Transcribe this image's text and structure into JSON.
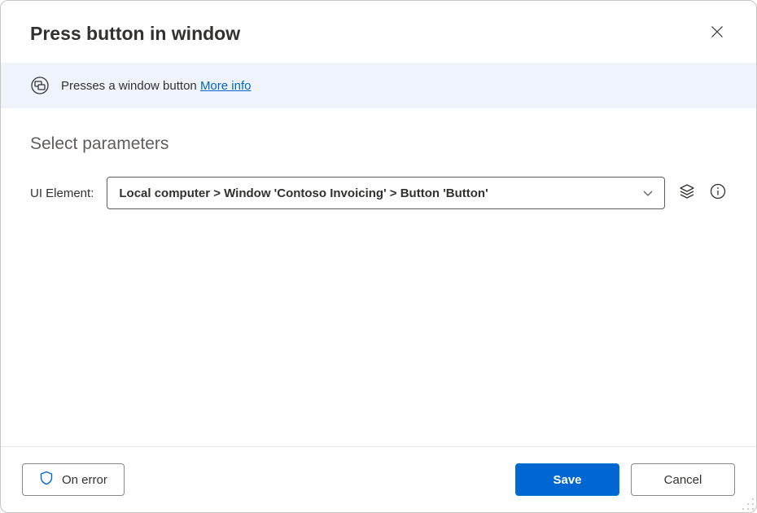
{
  "header": {
    "title": "Press button in window"
  },
  "info": {
    "description": "Presses a window button",
    "more_info_label": "More info"
  },
  "section": {
    "title": "Select parameters"
  },
  "param": {
    "label": "UI Element:",
    "value": "Local computer > Window 'Contoso Invoicing' > Button 'Button'"
  },
  "footer": {
    "on_error_label": "On error",
    "save_label": "Save",
    "cancel_label": "Cancel"
  }
}
